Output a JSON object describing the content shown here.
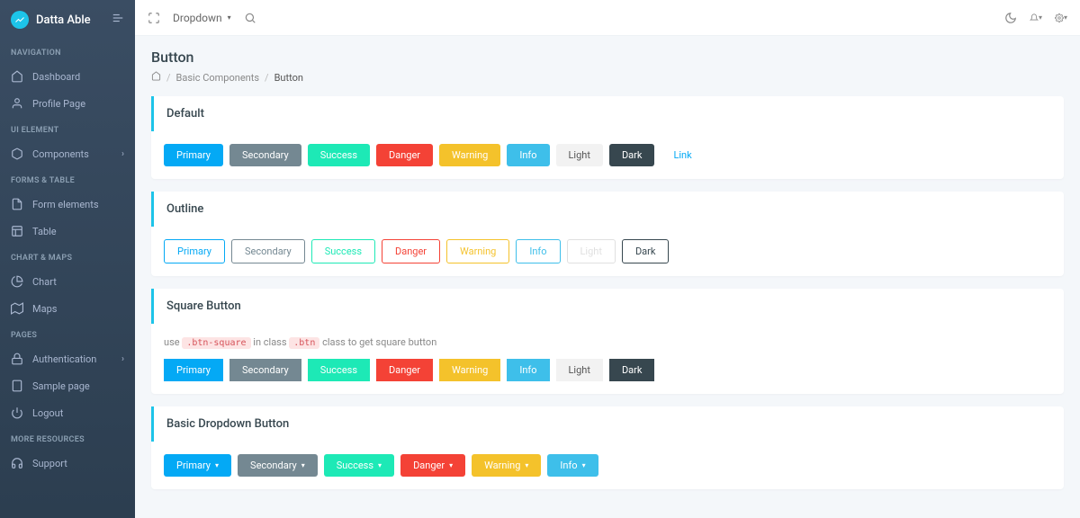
{
  "brand": "Datta Able",
  "sidebar": {
    "sections": [
      {
        "title": "NAVIGATION",
        "items": [
          {
            "label": "Dashboard",
            "icon": "home"
          },
          {
            "label": "Profile Page",
            "icon": "user"
          }
        ]
      },
      {
        "title": "UI ELEMENT",
        "items": [
          {
            "label": "Components",
            "icon": "box",
            "hasChildren": true
          }
        ]
      },
      {
        "title": "FORMS & TABLE",
        "items": [
          {
            "label": "Form elements",
            "icon": "file"
          },
          {
            "label": "Table",
            "icon": "table"
          }
        ]
      },
      {
        "title": "CHART & MAPS",
        "items": [
          {
            "label": "Chart",
            "icon": "pie"
          },
          {
            "label": "Maps",
            "icon": "map"
          }
        ]
      },
      {
        "title": "PAGES",
        "items": [
          {
            "label": "Authentication",
            "icon": "lock",
            "hasChildren": true
          },
          {
            "label": "Sample page",
            "icon": "page"
          },
          {
            "label": "Logout",
            "icon": "power"
          }
        ]
      },
      {
        "title": "MORE RESOURCES",
        "items": [
          {
            "label": "Support",
            "icon": "headphones"
          }
        ]
      }
    ]
  },
  "topbar": {
    "dropdown_label": "Dropdown"
  },
  "page": {
    "title": "Button",
    "breadcrumb": {
      "basic_components": "Basic Components",
      "button": "Button"
    }
  },
  "cards": {
    "default": {
      "title": "Default"
    },
    "outline": {
      "title": "Outline"
    },
    "square": {
      "title": "Square Button",
      "desc_pre": "use ",
      "code1": ".btn-square",
      "desc_mid": " in class ",
      "code2": ".btn",
      "desc_post": " class to get square button"
    },
    "dropdown": {
      "title": "Basic Dropdown Button"
    }
  },
  "buttons": {
    "primary": "Primary",
    "secondary": "Secondary",
    "success": "Success",
    "danger": "Danger",
    "warning": "Warning",
    "info": "Info",
    "light": "Light",
    "dark": "Dark",
    "link": "Link"
  }
}
